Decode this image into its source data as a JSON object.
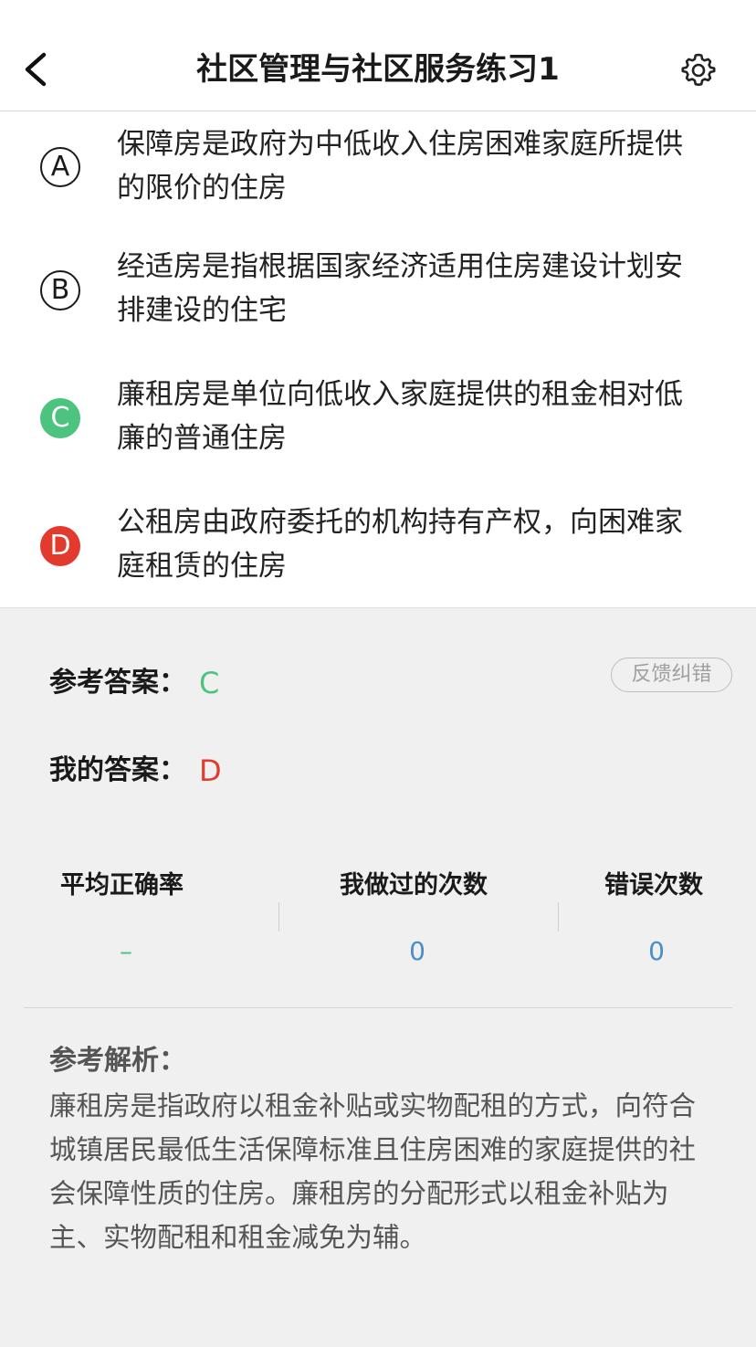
{
  "header": {
    "title": "社区管理与社区服务练习1",
    "back_icon": "chevron-left-icon",
    "settings_icon": "gear-icon"
  },
  "options": [
    {
      "letter": "A",
      "text": "保障房是政府为中低收入住房困难家庭所提供的限价的住房",
      "state": "none"
    },
    {
      "letter": "B",
      "text": "经适房是指根据国家经济适用住房建设计划安排建设的住宅",
      "state": "none"
    },
    {
      "letter": "C",
      "text": "廉租房是单位向低收入家庭提供的租金相对低廉的普通住房",
      "state": "correct"
    },
    {
      "letter": "D",
      "text": "公租房由政府委托的机构持有产权，向困难家庭租赁的住房",
      "state": "wrong"
    }
  ],
  "answers": {
    "reference_label": "参考答案：",
    "reference_value": "C",
    "mine_label": "我的答案：",
    "mine_value": "D",
    "feedback_label": "反馈纠错"
  },
  "stats": {
    "avg_label": "平均正确率",
    "avg_value": "–",
    "count_label": "我做过的次数",
    "count_value": "0",
    "errors_label": "错误次数",
    "errors_value": "0"
  },
  "analysis": {
    "label": "参考解析：",
    "text": "廉租房是指政府以租金补贴或实物配租的方式，向符合城镇居民最低生活保障标准且住房困难的家庭提供的社会保障性质的住房。廉租房的分配形式以租金补贴为主、实物配租和租金减免为辅。"
  },
  "colors": {
    "correct": "#4cc47f",
    "wrong": "#e23b2e",
    "stat_value": "#4a8ec9",
    "background": "#f0f0f0"
  }
}
